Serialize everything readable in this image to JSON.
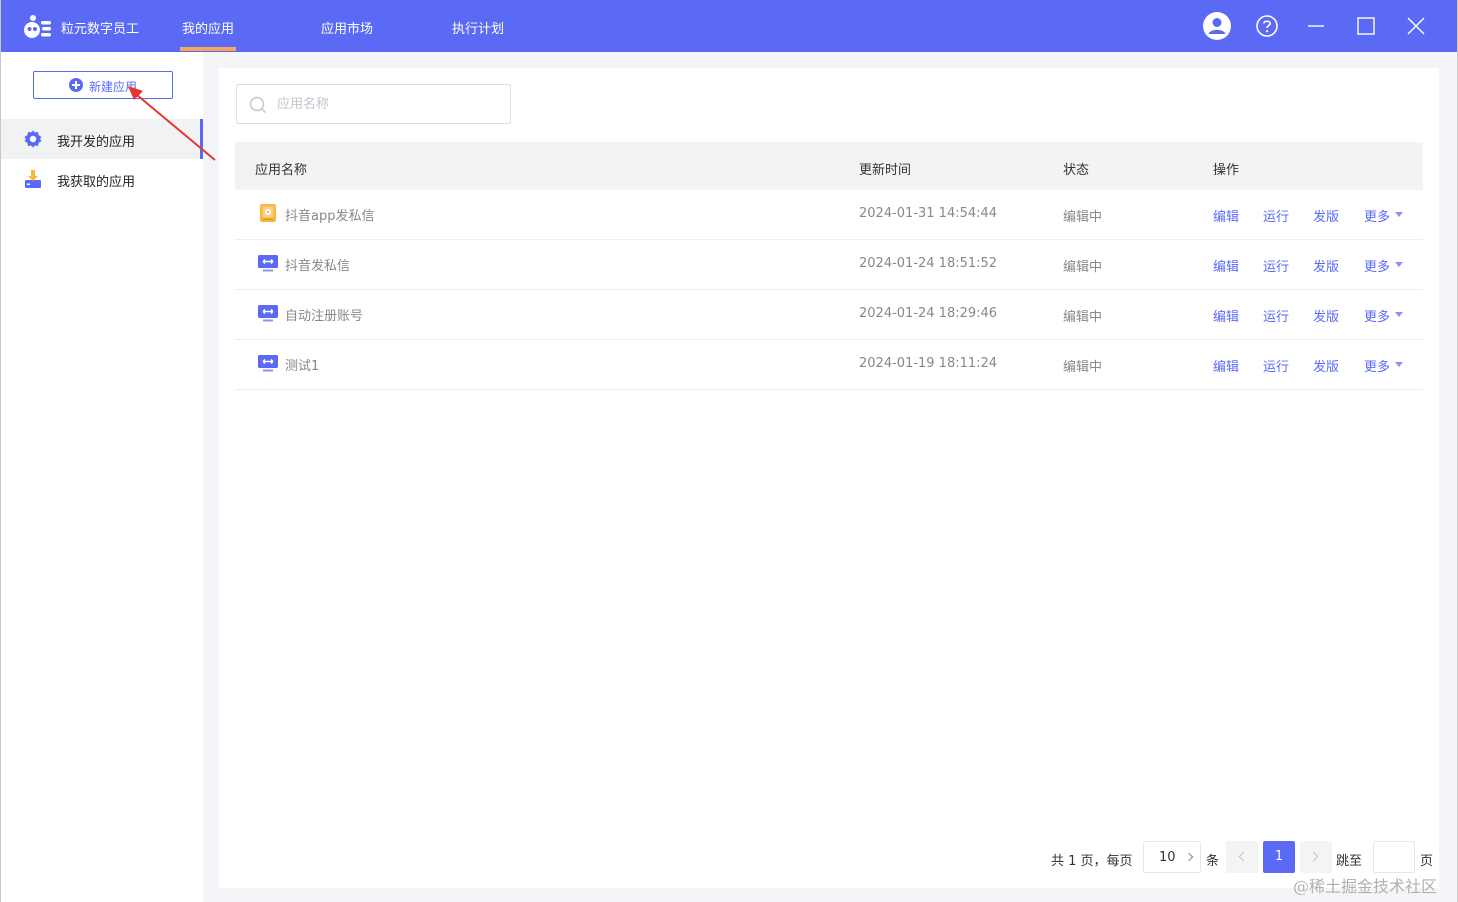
{
  "topbar": {
    "brand": "粒元数字员工",
    "tabs": [
      "我的应用",
      "应用市场",
      "执行计划"
    ],
    "active_tab_index": 0
  },
  "sidebar": {
    "new_button": "新建应用",
    "items": [
      {
        "label": "我开发的应用",
        "icon": "gear-icon",
        "active": true
      },
      {
        "label": "我获取的应用",
        "icon": "download-icon",
        "active": false
      }
    ]
  },
  "search": {
    "placeholder": "应用名称",
    "value": ""
  },
  "table": {
    "columns": [
      "应用名称",
      "更新时间",
      "状态",
      "操作"
    ],
    "rows": [
      {
        "name": "抖音app发私信",
        "time": "2024-01-31 14:54:44",
        "status": "编辑中",
        "icon": "mobile-app-icon"
      },
      {
        "name": "抖音发私信",
        "time": "2024-01-24 18:51:52",
        "status": "编辑中",
        "icon": "desktop-app-icon"
      },
      {
        "name": "自动注册账号",
        "time": "2024-01-24 18:29:46",
        "status": "编辑中",
        "icon": "desktop-app-icon"
      },
      {
        "name": "测试1",
        "time": "2024-01-19 18:11:24",
        "status": "编辑中",
        "icon": "desktop-app-icon"
      }
    ],
    "actions": [
      "编辑",
      "运行",
      "发版",
      "更多"
    ]
  },
  "pagination": {
    "total_text": "共 1 页，每页",
    "page_size": "10",
    "unit": "条",
    "current_page": "1",
    "jump_label": "跳至",
    "page_suffix": "页"
  },
  "watermark": "@稀土掘金技术社区",
  "colors": {
    "primary": "#5b6af5",
    "tab_underline": "#f5a65b",
    "annotation_arrow": "#e8362f"
  }
}
